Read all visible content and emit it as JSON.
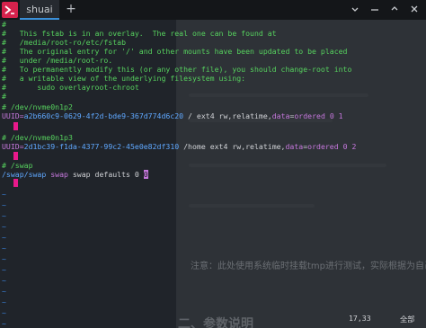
{
  "titlebar": {
    "tab_label": "shuai",
    "add_tab": "+"
  },
  "file_lines": [
    "#",
    "#   This fstab is in an overlay.  The real one can be found at",
    "#   /media/root-ro/etc/fstab",
    "#   The original entry for '/' and other mounts have been updated to be placed",
    "#   under /media/root-ro.",
    "#   To permanently modify this (or any other file), you should change-root into",
    "#   a writable view of the underlying filesystem using:",
    "#       sudo overlayroot-chroot",
    "#"
  ],
  "nvme_p2": {
    "comment": "# /dev/nvme0n1p2",
    "uuid_key": "UUID=",
    "uuid_value": "a2b660c9-0629-4f2d-bde9-367d774d6c20",
    "rest_plain": " / ext4 rw,relatime,",
    "data_opt": "data",
    "eq": "=",
    "ordered": "ordered",
    "tail": " 0 1"
  },
  "nvme_p3": {
    "comment": "# /dev/nvme0n1p3",
    "uuid_key": "UUID=",
    "uuid_value": "2d1bc39-f1da-4377-99c2-45e0e82df310",
    "rest_plain": " /home ext4 rw,relatime,",
    "data_opt": "data",
    "eq": "=",
    "ordered": "ordered",
    "tail": " 0 2"
  },
  "swap": {
    "comment": "# /swap",
    "path": "/swap/swap",
    "type1": " swap",
    "type2": " swap",
    "rest": " defaults 0 ",
    "cursor_char": "0"
  },
  "tilde": "~",
  "status": {
    "position": "17,33",
    "scroll": "全部"
  },
  "background_doc": {
    "note": "注意：此处使用系统临时挂载tmp进行测试，实际根据为自己的系统目录",
    "heading": "二、参数说明"
  },
  "colors": {
    "comment": "#56d15e",
    "uuid_key": "#c678dd",
    "uuid_value": "#5fa8ff",
    "tilde": "#3a7fd6",
    "cursor": "#e8198b",
    "tab_accent": "#3a8fd8",
    "app_icon": "#d5224c"
  },
  "icons": {
    "app": "terminal-app-icon",
    "dropdown": "chevron-down-icon",
    "minimize": "minimize-icon",
    "maximize": "maximize-icon",
    "close": "close-icon"
  }
}
